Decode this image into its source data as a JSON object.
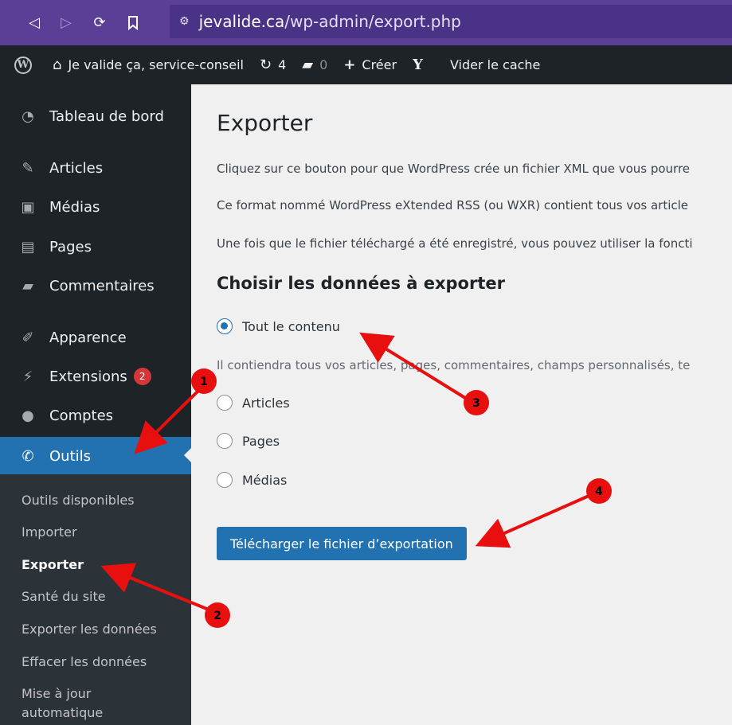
{
  "browser": {
    "url_domain": "jevalide.ca",
    "url_path": "/wp-admin/export.php"
  },
  "adminbar": {
    "site_name": "Je valide ça, service-conseil",
    "updates_count": "4",
    "comments_count": "0",
    "new_label": "Créer",
    "cache_label": "Vider le cache"
  },
  "sidebar": {
    "items": [
      {
        "label": "Tableau de bord"
      },
      {
        "label": "Articles"
      },
      {
        "label": "Médias"
      },
      {
        "label": "Pages"
      },
      {
        "label": "Commentaires"
      },
      {
        "label": "Apparence"
      },
      {
        "label": "Extensions",
        "badge": "2"
      },
      {
        "label": "Comptes"
      },
      {
        "label": "Outils"
      }
    ],
    "submenu": [
      {
        "label": "Outils disponibles"
      },
      {
        "label": "Importer"
      },
      {
        "label": "Exporter"
      },
      {
        "label": "Santé du site"
      },
      {
        "label": "Exporter les données"
      },
      {
        "label": "Effacer les données"
      },
      {
        "label": "Mise à jour"
      },
      {
        "label": "automatique"
      }
    ]
  },
  "main": {
    "title": "Exporter",
    "paragraphs": [
      "Cliquez sur ce bouton pour que WordPress crée un fichier XML que vous pourre",
      "Ce format nommé WordPress eXtended RSS (ou WXR) contient tous vos article",
      "Une fois que le fichier téléchargé a été enregistré, vous pouvez utiliser la foncti"
    ],
    "section_title": "Choisir les données à exporter",
    "options": [
      {
        "label": "Tout le contenu",
        "checked": true
      },
      {
        "label": "Articles",
        "checked": false
      },
      {
        "label": "Pages",
        "checked": false
      },
      {
        "label": "Médias",
        "checked": false
      }
    ],
    "help": "Il contiendra tous vos articles, pages, commentaires, champs personnalisés, te",
    "download_button": "Télécharger le fichier d’exportation"
  },
  "annotations": {
    "markers": [
      "1",
      "2",
      "3",
      "4"
    ],
    "color": "#e8100f"
  },
  "colors": {
    "browser_bar": "#5b3e96",
    "adminbar": "#1d2327",
    "accent": "#2271b1",
    "badge": "#d63638"
  }
}
